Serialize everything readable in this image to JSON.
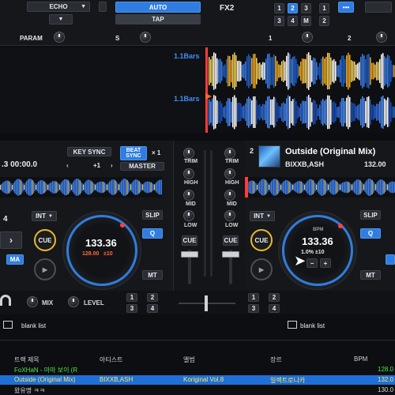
{
  "top": {
    "echo_label": "ECHO",
    "auto_label": "AUTO",
    "tap_label": "TAP",
    "fx_label": "FX2",
    "fx_slots_top": [
      "1",
      "2",
      "3"
    ],
    "fx_slots_bottom": [
      "3",
      "4",
      "M"
    ],
    "extra_slots": [
      "1",
      "2"
    ],
    "param_label": "PARAM",
    "param_s": "S",
    "param_right": [
      "1",
      "2"
    ]
  },
  "waveform": {
    "bars_label_1": "1.1Bars",
    "bars_label_2": "1.1Bars"
  },
  "left_deck": {
    "time": ".3  00:00.0",
    "key_sync_label": "KEY SYNC",
    "beat_sync_label": "BEAT SYNC",
    "mult": "× 1",
    "plus1": "+1",
    "master_label": "MASTER",
    "hotcue_num": "4",
    "int_label": "INT",
    "cue_label": "CUE",
    "ma_label": "MA",
    "bpm_value": "133.36",
    "bpm_orig": "128.00",
    "bpm_range": "±10",
    "slip_label": "SLIP",
    "q_label": "Q",
    "mt_label": "MT"
  },
  "mixer": {
    "trim": "TRIM",
    "high": "HIGH",
    "mid": "MID",
    "low": "LOW",
    "cue": "CUE"
  },
  "right_deck": {
    "deck_num": "2",
    "title": "Outside (Original Mix)",
    "artist": "BIXXB,ASH",
    "bpm_top": "132.00",
    "int_label": "INT",
    "cue_label": "CUE",
    "bpm_label": "BPM",
    "bpm_value": "133.36",
    "pitch": "1.0%  ±10",
    "slip_label": "SLIP",
    "q_label": "Q",
    "mt_label": "MT",
    "minus": "−",
    "plus": "+"
  },
  "bottom_controls": {
    "mix_label": "MIX",
    "level_label": "LEVEL",
    "grid_left": [
      "1",
      "2",
      "3",
      "4"
    ],
    "grid_right": [
      "1",
      "2",
      "3",
      "4"
    ]
  },
  "browser": {
    "left_list_label": "blank list",
    "right_list_label": "blank list",
    "columns": [
      "트랙 제목",
      "아티스트",
      "앨범",
      "장르",
      "BPM"
    ],
    "rows": [
      {
        "title": "FoXHaN - 마마 보이 (R",
        "artist": "",
        "album": "",
        "genre": "",
        "bpm": "128.0"
      },
      {
        "title": "Outside (Original Mix)",
        "artist": "BIXXB,ASH",
        "album": "Koriginal Vol.8",
        "genre": "일렉트로니카",
        "bpm": "132.0"
      },
      {
        "title": "왔유명 ㅋㅋ",
        "artist": "",
        "album": "",
        "genre": "",
        "bpm": "130.0"
      }
    ]
  },
  "colors": {
    "accent": "#2f7de0",
    "cue": "#e8b92a",
    "selected_row": "#1f6fd6",
    "green_text": "#4fe64a"
  }
}
